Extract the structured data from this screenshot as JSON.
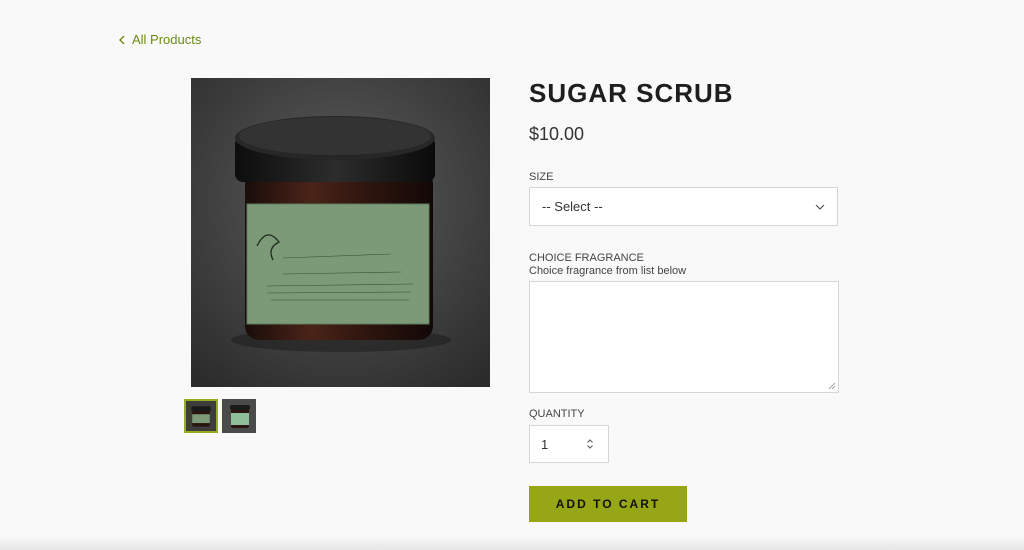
{
  "nav": {
    "back_label": "All Products"
  },
  "product": {
    "title": "SUGAR SCRUB",
    "price": "$10.00",
    "image_brand": "Brie's Body Boutique",
    "image_product": "Body Scrub",
    "thumbnails": [
      {
        "name": "jar-front",
        "active": true
      },
      {
        "name": "jar-side",
        "active": false
      }
    ]
  },
  "form": {
    "size_label": "SIZE",
    "size_value": "-- Select --",
    "fragrance_label": "CHOICE FRAGRANCE",
    "fragrance_help": "Choice fragrance from list below",
    "fragrance_value": "",
    "quantity_label": "QUANTITY",
    "quantity_value": "1",
    "add_to_cart_label": "ADD TO CART"
  },
  "colors": {
    "accent": "#97a617",
    "link": "#6b8a12",
    "active_thumb_border": "#9aad1f"
  }
}
